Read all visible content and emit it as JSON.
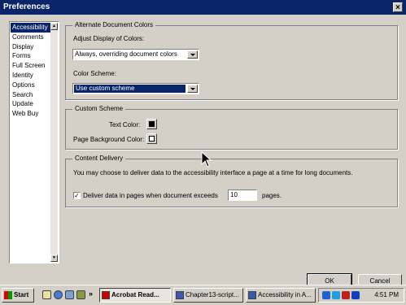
{
  "window": {
    "title": "Preferences",
    "close_glyph": "×"
  },
  "categories": {
    "items": [
      "Accessibility",
      "Comments",
      "Display",
      "Forms",
      "Full Screen",
      "Identity",
      "Options",
      "Search",
      "Update",
      "Web Buy"
    ],
    "selected": "Accessibility"
  },
  "alternate_colors": {
    "title": "Alternate Document Colors",
    "adjust_label": "Adjust Display of Colors:",
    "adjust_value": "Always, overriding document colors",
    "scheme_label": "Color Scheme:",
    "scheme_value": "Use custom scheme"
  },
  "custom_scheme": {
    "title": "Custom Scheme",
    "text_color_label": "Text Color:",
    "text_color": "#000000",
    "page_bg_label": "Page Background Color:",
    "page_bg_color": "#ffffff"
  },
  "content_delivery": {
    "title": "Content Delivery",
    "description": "You may choose to deliver data to the accessibility interface a page at a time for long documents.",
    "checkbox_label": "Deliver data in pages when document exceeds",
    "checkbox_checked": true,
    "check_glyph": "✓",
    "pages_value": "10",
    "pages_suffix": "pages."
  },
  "buttons": {
    "ok": "OK",
    "cancel": "Cancel"
  },
  "taskbar": {
    "start_label": "Start",
    "overflow_glyph": "»",
    "tasks": [
      "Acrobat Read...",
      "Chapter13-script...",
      "Accessibility in A..."
    ],
    "active_task": "Acrobat Read...",
    "clock": "4:51 PM"
  },
  "colors": {
    "title_bar": "#0a246a",
    "selection": "#0a246a",
    "face": "#d4d0c8"
  }
}
